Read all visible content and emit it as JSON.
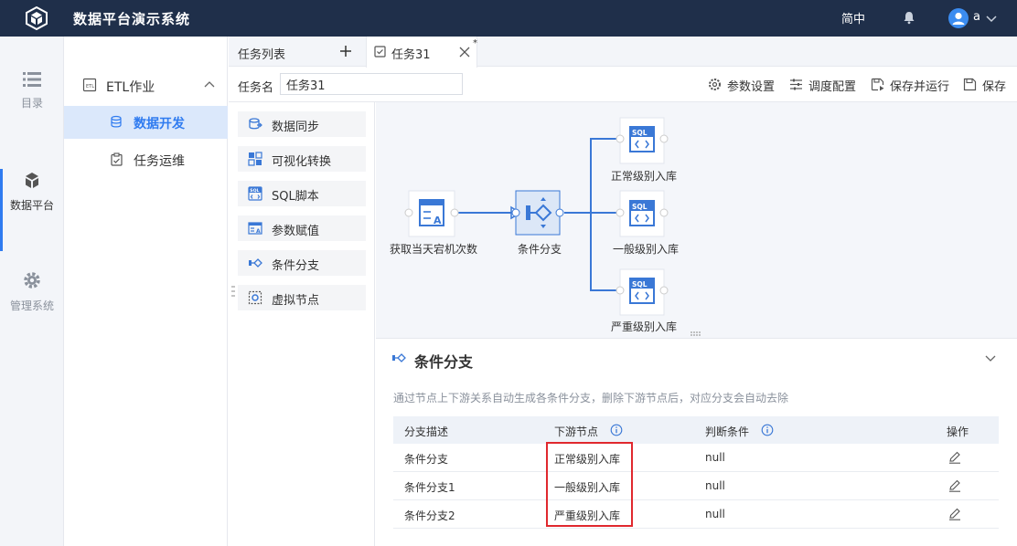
{
  "app": {
    "title": "数据平台演示系统",
    "lang": "简中",
    "user": "a"
  },
  "rail": [
    {
      "label": "目录",
      "icon": "list-icon"
    },
    {
      "label": "数据平台",
      "icon": "cube-icon",
      "active": true
    },
    {
      "label": "管理系统",
      "icon": "gear-icon"
    }
  ],
  "subnav": {
    "group": "ETL作业",
    "items": [
      {
        "label": "数据开发",
        "active": true
      },
      {
        "label": "任务运维"
      }
    ]
  },
  "tabs": {
    "list_label": "任务列表",
    "active_tab": "任务31",
    "dirty_mark": "*"
  },
  "task": {
    "name_label": "任务名",
    "name_value": "任务31",
    "toolbar": {
      "params": "参数设置",
      "schedule": "调度配置",
      "save_run": "保存并运行",
      "save": "保存"
    }
  },
  "palette": [
    "数据同步",
    "可视化转换",
    "SQL脚本",
    "参数赋值",
    "条件分支",
    "虚拟节点"
  ],
  "flow": {
    "source": "获取当天宕机次数",
    "branch": "条件分支",
    "targets": [
      "正常级别入库",
      "一般级别入库",
      "严重级别入库"
    ],
    "sql_badge": "SQL"
  },
  "panel": {
    "title": "条件分支",
    "hint": "通过节点上下游关系自动生成各条件分支，删除下游节点后，对应分支会自动去除",
    "columns": [
      "分支描述",
      "下游节点",
      "判断条件",
      "操作"
    ],
    "rows": [
      {
        "desc": "条件分支",
        "node": "正常级别入库",
        "cond": "null"
      },
      {
        "desc": "条件分支1",
        "node": "一般级别入库",
        "cond": "null"
      },
      {
        "desc": "条件分支2",
        "node": "严重级别入库",
        "cond": "null"
      }
    ]
  },
  "colors": {
    "accent": "#2f7bf0",
    "topbar": "#1f2f4a",
    "highlight": "#e0282e"
  }
}
